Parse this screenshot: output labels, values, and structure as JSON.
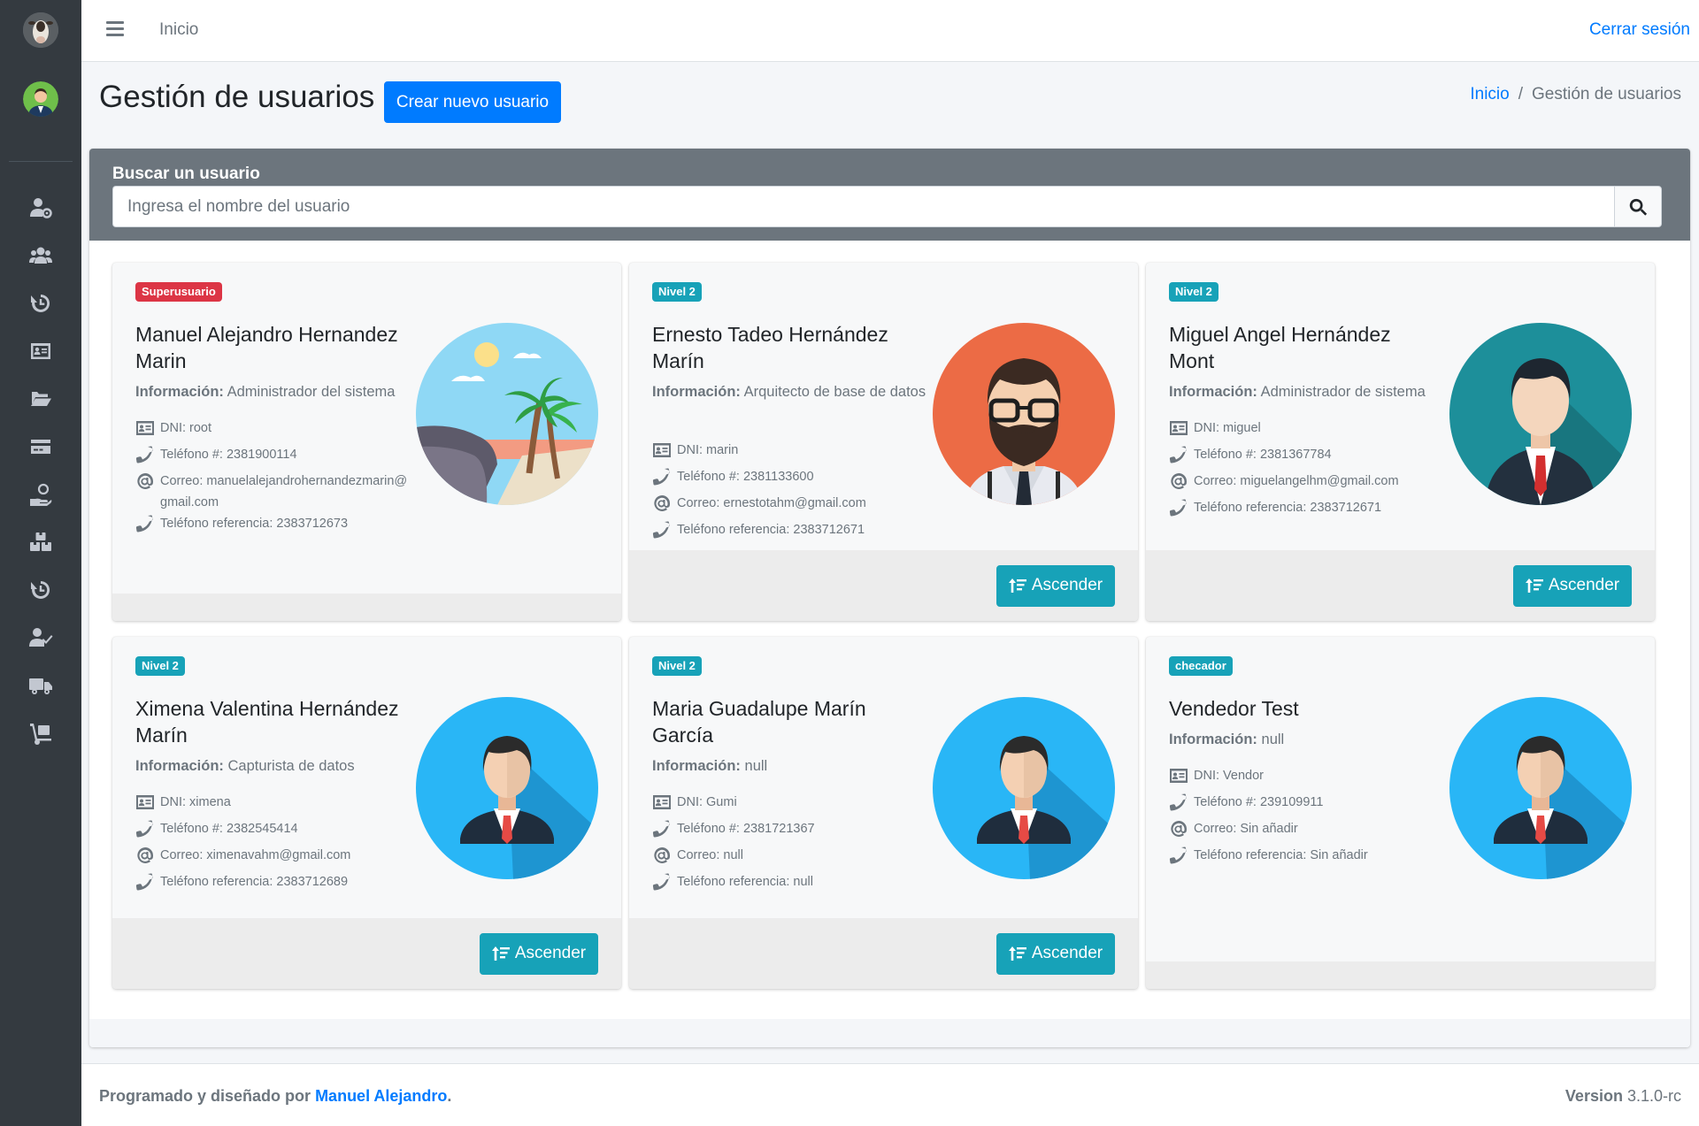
{
  "topbar": {
    "home_label": "Inicio",
    "logout_label": "Cerrar sesión"
  },
  "header": {
    "title": "Gestión de usuarios",
    "create_label": "Crear nuevo usuario",
    "breadcrumb": {
      "home": "Inicio",
      "separator": "/",
      "current": "Gestión de usuarios"
    }
  },
  "search": {
    "label": "Buscar un usuario",
    "placeholder": "Ingresa el nombre del usuario"
  },
  "labels": {
    "info": "Información:",
    "dni": "DNI:",
    "phone": "Teléfono #:",
    "email": "Correo:",
    "ref_phone": "Teléfono referencia:",
    "ascend": "Ascender"
  },
  "users": [
    {
      "badge": "Superusuario",
      "badge_color": "#dc3545",
      "name": "Manuel Alejandro Hernandez Marin",
      "info": "Administrador del sistema",
      "dni": "root",
      "phone": "2381900114",
      "email": "manuelalejandrohernandezmarin@gmail.com",
      "ref_phone": "2383712673",
      "avatar": "beach-avatar",
      "ascend": false
    },
    {
      "badge": "Nivel 2",
      "badge_color": "#17a2b8",
      "name": "Ernesto Tadeo Hernández Marín",
      "info": "Arquitecto de base de datos",
      "dni": "marin",
      "phone": "2381133600",
      "email": "ernestotahm@gmail.com",
      "ref_phone": "2383712671",
      "avatar": "bearded-man-avatar",
      "ascend": true
    },
    {
      "badge": "Nivel 2",
      "badge_color": "#17a2b8",
      "name": "Miguel Angel Hernández Mont",
      "info": "Administrador de sistema",
      "dni": "miguel",
      "phone": "2381367784",
      "email": "miguelangelhm@gmail.com",
      "ref_phone": "2383712671",
      "avatar": "man-suit-teal-avatar",
      "ascend": true
    },
    {
      "badge": "Nivel 2",
      "badge_color": "#17a2b8",
      "name": "Ximena Valentina Hernández Marín",
      "info": "Capturista de datos",
      "dni": "ximena",
      "phone": "2382545414",
      "email": "ximenavahm@gmail.com",
      "ref_phone": "2383712689",
      "avatar": "default-user-avatar",
      "ascend": true
    },
    {
      "badge": "Nivel 2",
      "badge_color": "#17a2b8",
      "name": "Maria Guadalupe Marín García",
      "info": "null",
      "dni": "Gumi",
      "phone": "2381721367",
      "email": "null",
      "ref_phone": "null",
      "avatar": "default-user-avatar",
      "ascend": true
    },
    {
      "badge": "checador",
      "badge_color": "#17a2b8",
      "name": "Vendedor Test",
      "info": "null",
      "dni": "Vendor",
      "phone": "239109911",
      "email": "Sin añadir",
      "ref_phone": "Sin añadir",
      "avatar": "default-user-avatar",
      "ascend": false
    }
  ],
  "footer": {
    "prefix": "Programado y diseñado por",
    "author": "Manuel Alejandro",
    "suffix": ".",
    "version_label": "Version",
    "version": "3.1.0-rc"
  },
  "sidebar_icons": [
    "users-cog-icon",
    "users-icon",
    "history-icon",
    "id-card-icon",
    "folder-open-icon",
    "credit-card-icon",
    "hand-holding-usd-icon",
    "boxes-icon",
    "history-icon",
    "user-check-icon",
    "truck-icon",
    "dolly-icon"
  ]
}
